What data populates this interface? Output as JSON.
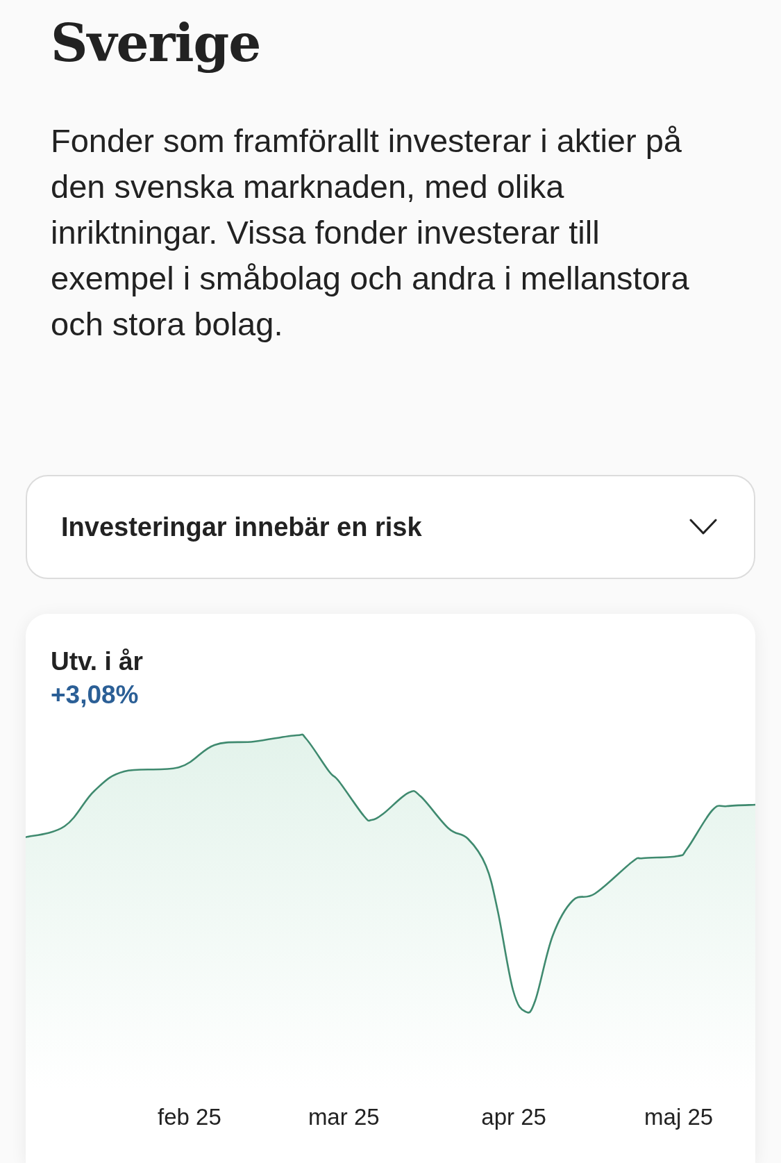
{
  "page": {
    "title": "Sverige",
    "description": "Fonder som framförallt investerar i aktier på den svenska marknaden, med olika inriktningar. Vissa fonder investerar till exempel i småbolag och andra i mellanstora och stora bolag."
  },
  "disclosure": {
    "label": "Investeringar innebär en risk",
    "expanded": false
  },
  "performance": {
    "label": "Utv. i år",
    "value": "+3,08%",
    "x_labels": [
      "feb 25",
      "mar 25",
      "apr 25",
      "maj 25"
    ]
  }
}
